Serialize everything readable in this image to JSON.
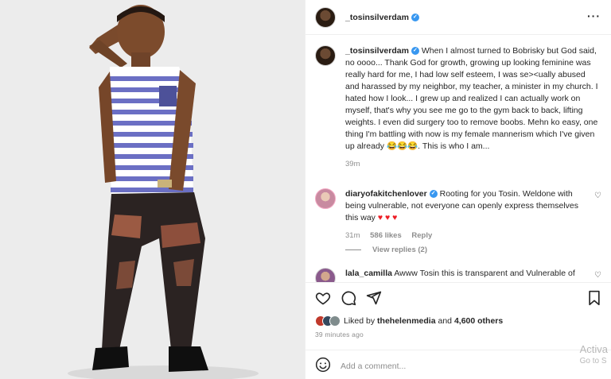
{
  "post": {
    "author": "_tosinsilverdam",
    "more_icon": "ellipsis-icon",
    "caption": {
      "username": "_tosinsilverdam",
      "text": "When I almost turned to Bobrisky but God said, no oooo... Thank God for growth, growing up looking feminine was really hard for me, I had low self esteem, I was se><ually abused and harassed by my neighbor, my teacher, a minister in my church. I hated how I look... I grew up and realized I can actually work on myself, that's why you see me go to the gym back to back, lifting weights. I even did surgery too to remove boobs. Mehn ko easy, one thing I'm battling with now is my female mannerism which I've given up already 😂😂😂. This is who I am...",
      "age": "39m"
    },
    "comments": [
      {
        "username": "diaryofakitchenlover",
        "text": "Rooting for you Tosin. Weldone with being vulnerable, not everyone can openly express themselves this way",
        "hearts": "♥ ♥ ♥",
        "age": "31m",
        "likes": "586 likes",
        "reply": "Reply"
      },
      {
        "username": "lala_camilla",
        "text": "Awww Tosin this is transparent and Vulnerable of"
      }
    ],
    "view_replies": "View replies (2)",
    "liked_by_prefix": "Liked by",
    "liked_by_user": "thehelenmedia",
    "liked_by_and": "and",
    "liked_by_others": "4,600 others",
    "timestamp": "39 minutes ago",
    "add_comment_placeholder": "Add a comment...",
    "colors": {
      "verified": "#3897f0",
      "meta": "#8e8e8e",
      "heart_red": "#ed1c24"
    }
  },
  "watermark": {
    "line1": "Activa",
    "line2": "Go to S"
  }
}
